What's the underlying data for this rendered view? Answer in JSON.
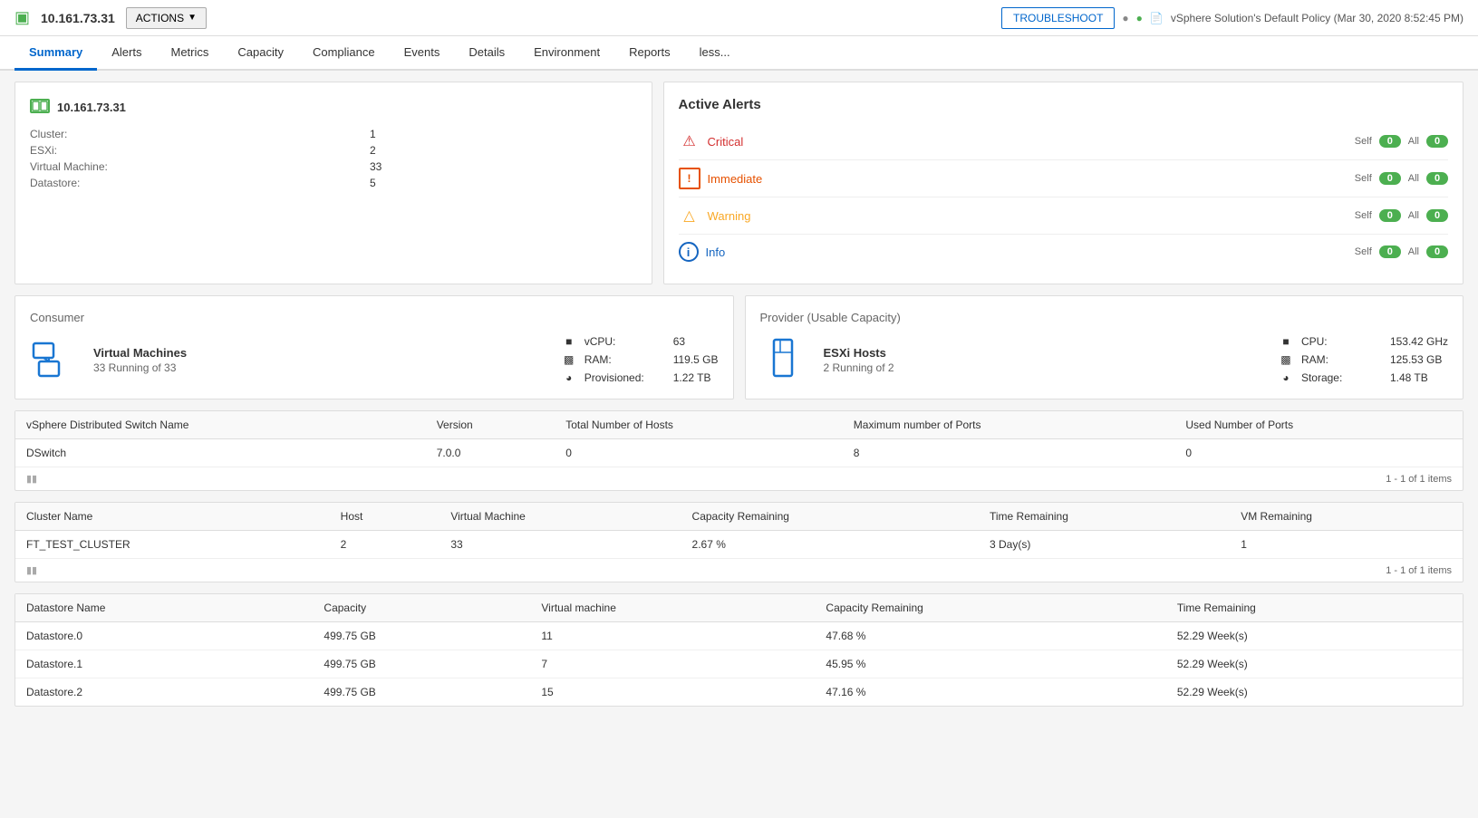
{
  "header": {
    "ip": "10.161.73.31",
    "actions_label": "ACTIONS",
    "troubleshoot_label": "TROUBLESHOOT",
    "policy_text": "vSphere Solution's Default Policy (Mar 30, 2020 8:52:45 PM)"
  },
  "nav": {
    "tabs": [
      {
        "id": "summary",
        "label": "Summary",
        "active": true
      },
      {
        "id": "alerts",
        "label": "Alerts",
        "active": false
      },
      {
        "id": "metrics",
        "label": "Metrics",
        "active": false
      },
      {
        "id": "capacity",
        "label": "Capacity",
        "active": false
      },
      {
        "id": "compliance",
        "label": "Compliance",
        "active": false
      },
      {
        "id": "events",
        "label": "Events",
        "active": false
      },
      {
        "id": "details",
        "label": "Details",
        "active": false
      },
      {
        "id": "environment",
        "label": "Environment",
        "active": false
      },
      {
        "id": "reports",
        "label": "Reports",
        "active": false
      },
      {
        "id": "less",
        "label": "less...",
        "active": false
      }
    ]
  },
  "summary_panel": {
    "title": "10.161.73.31",
    "cluster_label": "Cluster:",
    "cluster_value": "1",
    "esxi_label": "ESXi:",
    "esxi_value": "2",
    "vm_label": "Virtual Machine:",
    "vm_value": "33",
    "datastore_label": "Datastore:",
    "datastore_value": "5"
  },
  "alerts_panel": {
    "title": "Active Alerts",
    "alerts": [
      {
        "id": "critical",
        "label": "Critical",
        "type": "critical",
        "self": "0",
        "all": "0"
      },
      {
        "id": "immediate",
        "label": "Immediate",
        "type": "immediate",
        "self": "0",
        "all": "0"
      },
      {
        "id": "warning",
        "label": "Warning",
        "type": "warning",
        "self": "0",
        "all": "0"
      },
      {
        "id": "info",
        "label": "Info",
        "type": "info",
        "self": "0",
        "all": "0"
      }
    ],
    "self_label": "Self",
    "all_label": "All"
  },
  "consumer": {
    "title": "Consumer",
    "resource_name": "Virtual Machines",
    "resource_status": "33 Running of 33",
    "vcpu_label": "vCPU:",
    "vcpu_value": "63",
    "ram_label": "RAM:",
    "ram_value": "119.5 GB",
    "provisioned_label": "Provisioned:",
    "provisioned_value": "1.22 TB"
  },
  "provider": {
    "title": "Provider (Usable Capacity)",
    "resource_name": "ESXi Hosts",
    "resource_status": "2 Running of 2",
    "cpu_label": "CPU:",
    "cpu_value": "153.42 GHz",
    "ram_label": "RAM:",
    "ram_value": "125.53 GB",
    "storage_label": "Storage:",
    "storage_value": "1.48 TB"
  },
  "distributed_switch_table": {
    "columns": [
      {
        "id": "name",
        "label": "vSphere Distributed Switch Name"
      },
      {
        "id": "version",
        "label": "Version"
      },
      {
        "id": "total_hosts",
        "label": "Total Number of Hosts"
      },
      {
        "id": "max_ports",
        "label": "Maximum number of Ports"
      },
      {
        "id": "used_ports",
        "label": "Used Number of Ports"
      }
    ],
    "rows": [
      {
        "name": "DSwitch",
        "version": "7.0.0",
        "total_hosts": "0",
        "max_ports": "8",
        "used_ports": "0"
      }
    ],
    "pagination": "1 - 1 of 1 items"
  },
  "cluster_table": {
    "columns": [
      {
        "id": "cluster_name",
        "label": "Cluster Name"
      },
      {
        "id": "host",
        "label": "Host"
      },
      {
        "id": "virtual_machine",
        "label": "Virtual Machine"
      },
      {
        "id": "capacity_remaining",
        "label": "Capacity Remaining"
      },
      {
        "id": "time_remaining",
        "label": "Time Remaining"
      },
      {
        "id": "vm_remaining",
        "label": "VM Remaining"
      }
    ],
    "rows": [
      {
        "cluster_name": "FT_TEST_CLUSTER",
        "host": "2",
        "virtual_machine": "33",
        "capacity_remaining": "2.67 %",
        "time_remaining": "3 Day(s)",
        "vm_remaining": "1"
      }
    ],
    "pagination": "1 - 1 of 1 items"
  },
  "datastore_table": {
    "columns": [
      {
        "id": "datastore_name",
        "label": "Datastore Name"
      },
      {
        "id": "capacity",
        "label": "Capacity"
      },
      {
        "id": "virtual_machine",
        "label": "Virtual machine"
      },
      {
        "id": "capacity_remaining",
        "label": "Capacity Remaining"
      },
      {
        "id": "time_remaining",
        "label": "Time Remaining"
      }
    ],
    "rows": [
      {
        "datastore_name": "Datastore.0",
        "capacity": "499.75 GB",
        "virtual_machine": "11",
        "capacity_remaining": "47.68 %",
        "time_remaining": "52.29 Week(s)"
      },
      {
        "datastore_name": "Datastore.1",
        "capacity": "499.75 GB",
        "virtual_machine": "7",
        "capacity_remaining": "45.95 %",
        "time_remaining": "52.29 Week(s)"
      },
      {
        "datastore_name": "Datastore.2",
        "capacity": "499.75 GB",
        "virtual_machine": "15",
        "capacity_remaining": "47.16 %",
        "time_remaining": "52.29 Week(s)"
      }
    ]
  }
}
